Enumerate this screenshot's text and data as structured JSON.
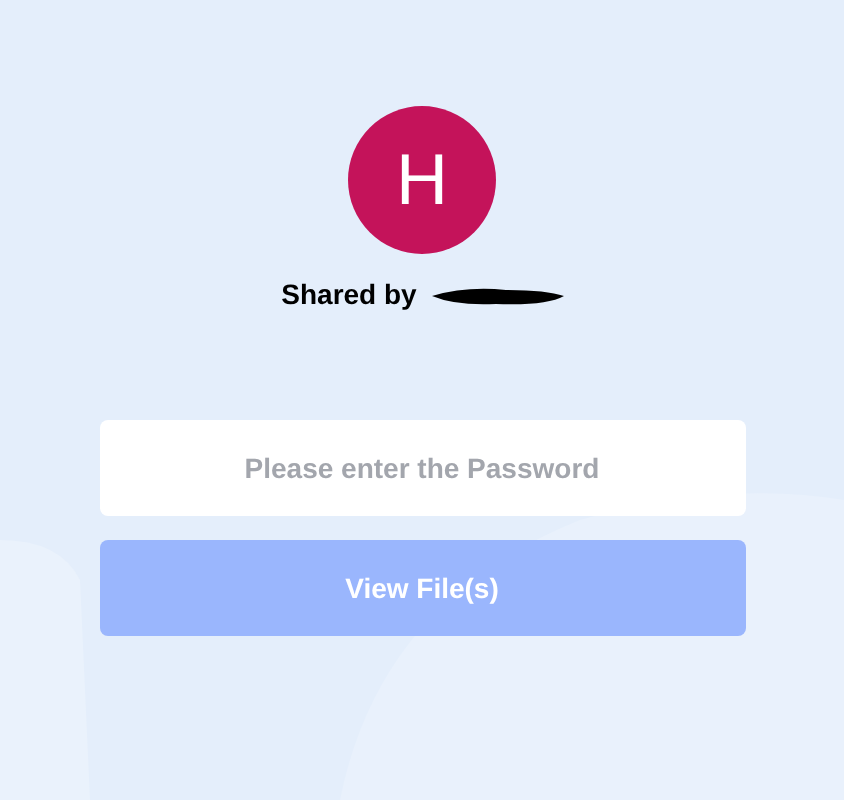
{
  "avatar": {
    "initial": "H"
  },
  "shared_by": {
    "label": "Shared by",
    "name_redacted": true
  },
  "password_field": {
    "placeholder": "Please enter the Password"
  },
  "view_button": {
    "label": "View File(s)",
    "disabled": true
  }
}
